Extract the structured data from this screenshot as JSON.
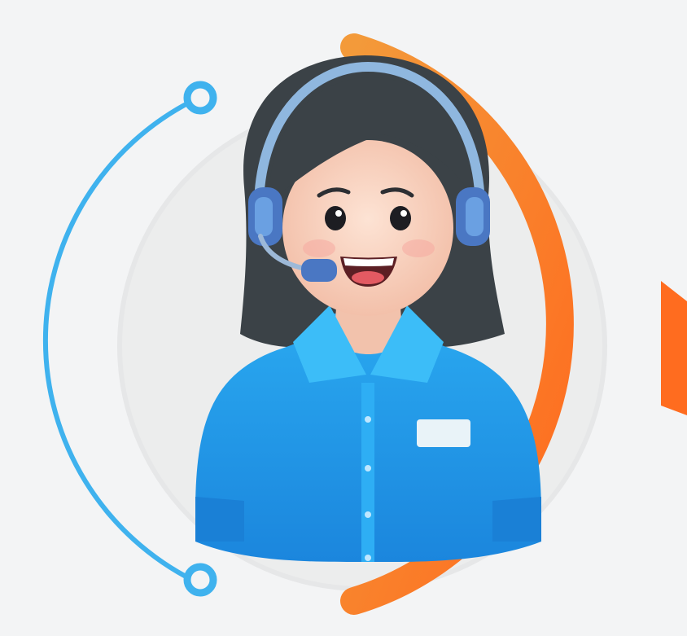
{
  "illustration": {
    "subject": "customer-support-agent",
    "icons": [
      "headset-icon",
      "name-badge-icon"
    ]
  },
  "colors": {
    "background": "#f3f4f5",
    "inner_circle": "#eceded",
    "left_arc": "#3fb2ee",
    "orange_arc_start": "#f39a3a",
    "orange_arc_end": "#ff6a1e",
    "hair": "#3b4247",
    "skin": "#f7d3c0",
    "shirt": "#1e9be6",
    "shirt_light": "#39bdf7",
    "headset": "#6b8fc6",
    "badge": "#e9f3f8"
  }
}
